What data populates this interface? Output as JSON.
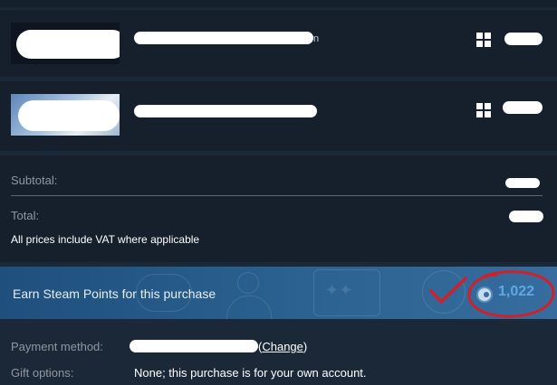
{
  "cart": {
    "items": [
      {
        "stray_char": "n",
        "platform_icon": "windows-icon"
      },
      {
        "platform_icon": "windows-icon"
      }
    ]
  },
  "summary": {
    "subtotal_label": "Subtotal:",
    "total_label": "Total:",
    "vat_note": "All prices include VAT where applicable"
  },
  "points": {
    "banner_text": "Earn Steam Points for this purchase",
    "value": "1,022",
    "icon": "steam-points-icon",
    "annotation_color": "#d0202a"
  },
  "payment": {
    "method_label": "Payment method:",
    "change_open": "(",
    "change_link": "Change",
    "change_close": ")",
    "gift_label": "Gift options:",
    "gift_value": "None; this purchase is for your own account."
  },
  "colors": {
    "background": "#1b2838",
    "panel": "#16202d",
    "banner": "#2b6291",
    "points_blue": "#5fa8e8"
  }
}
